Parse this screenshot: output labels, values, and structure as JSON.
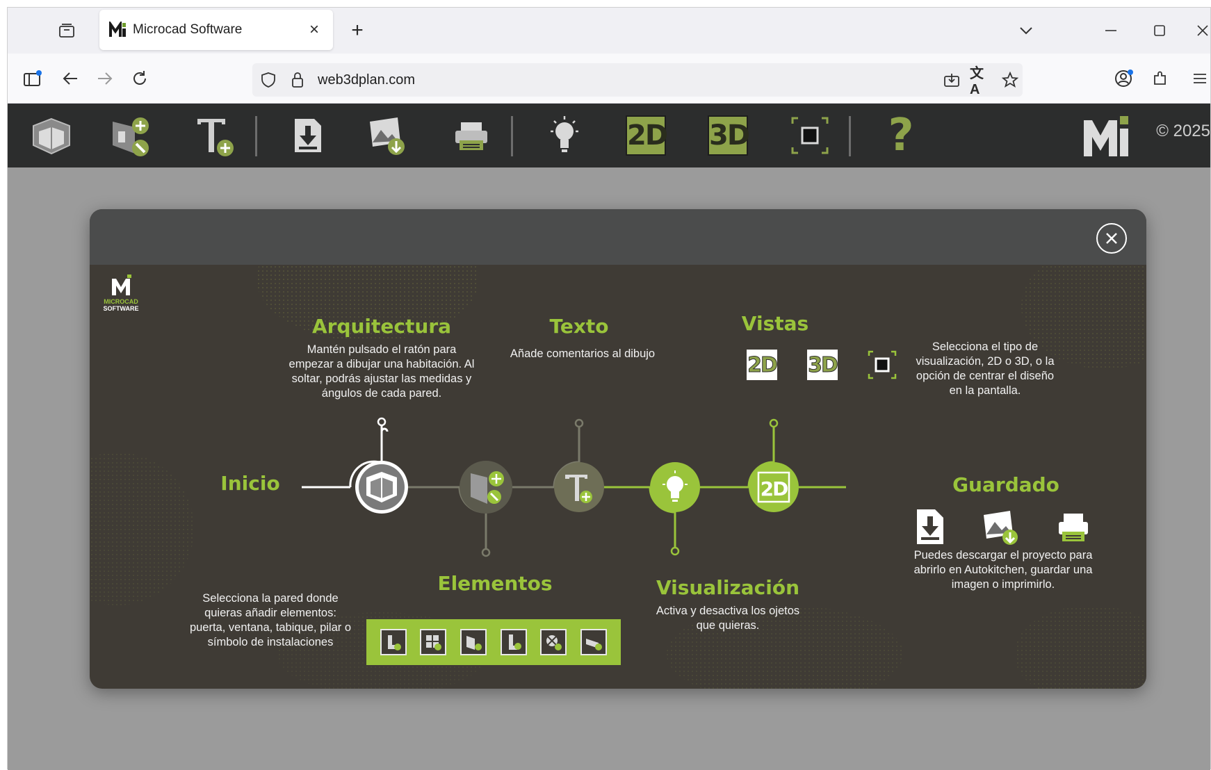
{
  "browser": {
    "tab_title": "Microcad Software",
    "url": "web3dplan.com",
    "icons": [
      "tab-overview-icon",
      "close-icon",
      "new-tab-icon",
      "tab-list-icon",
      "minimize-icon",
      "maximize-icon",
      "window-close-icon",
      "sidebar-icon",
      "back-icon",
      "forward-icon",
      "reload-icon",
      "shield-icon",
      "lock-icon",
      "install-app-icon",
      "translate-icon",
      "bookmark-star-icon",
      "account-icon",
      "extensions-icon",
      "menu-icon"
    ]
  },
  "toolbar": {
    "view2d_label": "2D",
    "view3d_label": "3D",
    "help_label": "?",
    "copyright": "© 2025",
    "icons": [
      "architecture-icon",
      "elements-icon",
      "text-icon",
      "download-icon",
      "save-image-icon",
      "print-icon",
      "lightbulb-icon",
      "view-2d-icon",
      "view-3d-icon",
      "center-icon",
      "help-icon",
      "microcad-logo-icon"
    ]
  },
  "modal": {
    "logo_lines": [
      "MICROCAD",
      "SOFTWARE"
    ],
    "inicio": {
      "title": "Inicio"
    },
    "arquitectura": {
      "title": "Arquitectura",
      "text": "Mantén pulsado el ratón para empezar a dibujar una habitación. Al soltar, podrás ajustar las medidas y ángulos de cada pared."
    },
    "texto": {
      "title": "Texto",
      "text": "Añade comentarios al dibujo"
    },
    "vistas": {
      "title": "Vistas",
      "text": "Selecciona el tipo de visualización, 2D o 3D, o la opción de centrar el diseño en la pantalla.",
      "label_2d": "2D",
      "label_3d": "3D"
    },
    "elementos": {
      "title": "Elementos",
      "text": "Selecciona la pared donde quieras añadir elementos: puerta, ventana, tabique, pilar o símbolo de instalaciones"
    },
    "visualizacion": {
      "title": "Visualización",
      "text": "Activa y desactiva los ojetos que quieras."
    },
    "guardado": {
      "title": "Guardado",
      "text": "Puedes  descargar el proyecto para abrirlo en Autokitchen, guardar una imagen o imprimirlo."
    },
    "timeline_node_2d": "2D"
  },
  "colors": {
    "accent_green": "#9ac43b",
    "modal_bg": "#3f3b35",
    "toolbar_bg": "#2c2d2d",
    "overlay_bg": "#9b9b9b"
  }
}
